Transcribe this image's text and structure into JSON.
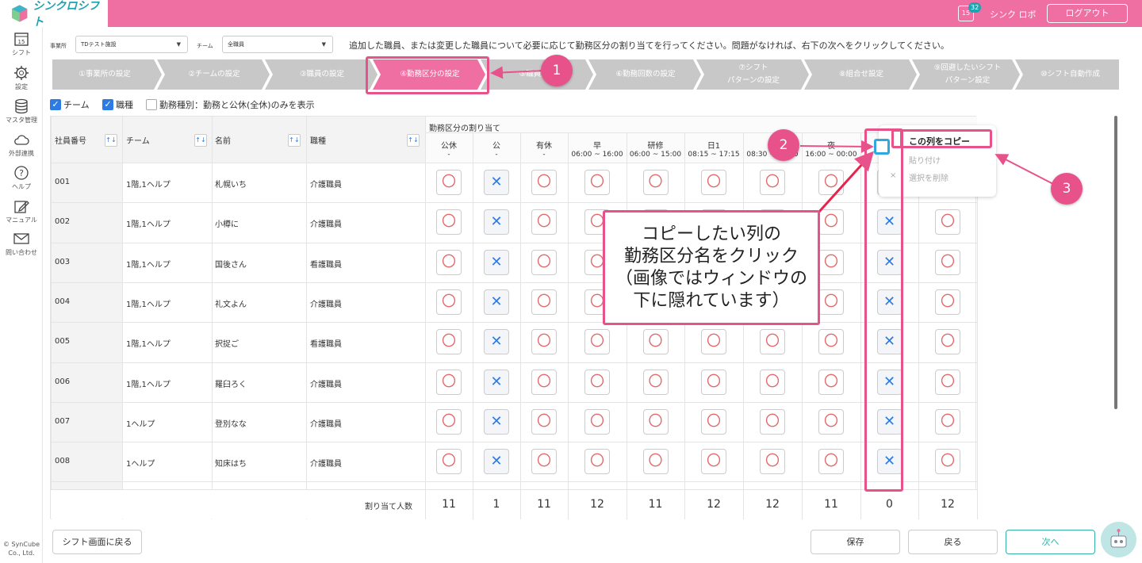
{
  "app": {
    "logo_text": "シンクロシフト",
    "notification_count": "32",
    "calendar_day": "15",
    "user_name": "シンク ロボ",
    "logout_label": "ログアウト"
  },
  "sidebar": {
    "items": [
      {
        "label": "シフト",
        "icon": "calendar-icon"
      },
      {
        "label": "設定",
        "icon": "gear-icon"
      },
      {
        "label": "マスタ管理",
        "icon": "database-icon"
      },
      {
        "label": "外部連携",
        "icon": "cloud-icon"
      },
      {
        "label": "ヘルプ",
        "icon": "help-icon"
      },
      {
        "label": "マニュアル",
        "icon": "pencil-icon"
      },
      {
        "label": "問い合わせ",
        "icon": "mail-icon"
      }
    ],
    "copyright": "© SynCube Co., Ltd."
  },
  "filters": {
    "office_label": "事業所",
    "office_value": "TDテスト施設",
    "team_label": "チーム",
    "team_value": "全職員"
  },
  "instruction": "追加した職員、または変更した職員について必要に応じて勤務区分の割り当てを行ってください。問題がなければ、右下の次へをクリックしてください。",
  "steps": [
    {
      "label": "①事業所の設定"
    },
    {
      "label": "②チームの設定"
    },
    {
      "label": "③職員の設定"
    },
    {
      "label": "④勤務区分の設定"
    },
    {
      "label": "⑤職員入力"
    },
    {
      "label": "⑥勤務回数の設定"
    },
    {
      "label": "⑦シフト パターンの設定"
    },
    {
      "label": "⑧組合せ設定"
    },
    {
      "label": "⑨回避したいシフト パターン設定"
    },
    {
      "label": "⑩シフト自動作成"
    }
  ],
  "checkboxes": [
    {
      "label": "チーム",
      "checked": true
    },
    {
      "label": "職種",
      "checked": true
    },
    {
      "label": "勤務種別：勤務と公休(全休)のみを表示",
      "checked": false
    }
  ],
  "table": {
    "headers": {
      "id": "社員番号",
      "team": "チーム",
      "name": "名前",
      "job": "職種",
      "assign": "勤務区分の割り当て"
    },
    "sort_icon": "↑↓",
    "shift_columns": [
      {
        "name": "公休",
        "time": "-"
      },
      {
        "name": "公",
        "time": "-"
      },
      {
        "name": "有休",
        "time": "-"
      },
      {
        "name": "早",
        "time": "06:00 ~ 16:00"
      },
      {
        "name": "研修",
        "time": "06:00 ~ 15:00"
      },
      {
        "name": "日1",
        "time": "08:15 ~ 17:15"
      },
      {
        "name": "遅",
        "time": "08:30 ~ 16:00"
      },
      {
        "name": "夜",
        "time": "16:00 ~ 00:00"
      },
      {
        "name": "",
        "time": ""
      },
      {
        "name": "",
        "time": ""
      }
    ],
    "rows": [
      {
        "id": "001",
        "team": "1階,1ヘルプ",
        "name": "札幌いち",
        "job": "介護職員"
      },
      {
        "id": "002",
        "team": "1階,1ヘルプ",
        "name": "小樽に",
        "job": "介護職員"
      },
      {
        "id": "003",
        "team": "1階,1ヘルプ",
        "name": "国後さん",
        "job": "看護職員"
      },
      {
        "id": "004",
        "team": "1階,1ヘルプ",
        "name": "礼文よん",
        "job": "介護職員"
      },
      {
        "id": "005",
        "team": "1階,1ヘルプ",
        "name": "択捉ご",
        "job": "看護職員"
      },
      {
        "id": "006",
        "team": "1階,1ヘルプ",
        "name": "羅臼ろく",
        "job": "介護職員"
      },
      {
        "id": "007",
        "team": "1ヘルプ",
        "name": "登別なな",
        "job": "介護職員"
      },
      {
        "id": "008",
        "team": "1ヘルプ",
        "name": "知床はち",
        "job": "介護職員"
      }
    ],
    "mark_o": "〇",
    "mark_x": "✕",
    "totals_label": "割り当て人数",
    "totals": [
      "11",
      "1",
      "11",
      "12",
      "11",
      "12",
      "12",
      "11",
      "0",
      "12"
    ]
  },
  "context_menu": {
    "copy": "この列をコピー",
    "paste": "貼り付け",
    "delete": "選択を削除",
    "delete_icon": "×"
  },
  "callout_text": [
    "コピーしたい列の",
    "勤務区分名をクリック",
    "（画像ではウィンドウの",
    "下に隠れています）"
  ],
  "annotations": [
    "1",
    "2",
    "3"
  ],
  "buttons": {
    "back_to_shift": "シフト画面に戻る",
    "save": "保存",
    "back": "戻る",
    "next": "次へ"
  },
  "colors": {
    "brand_pink": "#f06fa2",
    "annotation_pink": "#e8528a",
    "accent_blue": "#2d7be5",
    "teal": "#17a6b2",
    "step_gray": "#c8c8c8"
  }
}
